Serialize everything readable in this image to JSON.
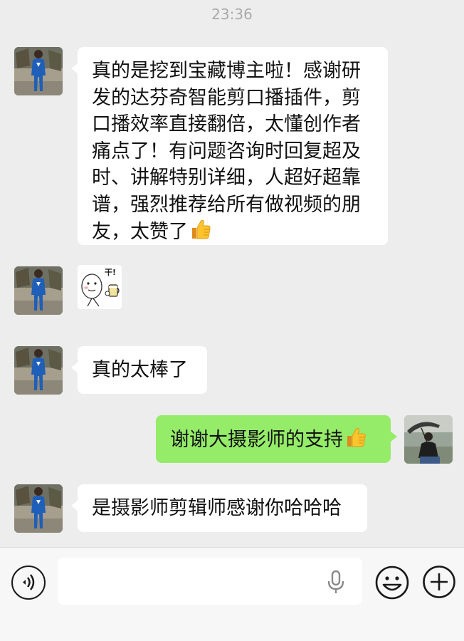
{
  "chat": {
    "timestamp": "23:36",
    "messages": [
      {
        "from": "contact",
        "type": "text",
        "text": "真的是挖到宝藏博主啦！感谢研发的达芬奇智能剪口播插件，剪口播效率直接翻倍，太懂创作者痛点了！有问题咨询时回复超及时、讲解特别详细，人超好超靠谱，强烈推荐给所有做视频的朋友，太赞了",
        "emoji": "thumbs-up-icon"
      },
      {
        "from": "contact",
        "type": "sticker",
        "sticker_text": "干!",
        "icon": "cheers-sticker"
      },
      {
        "from": "contact",
        "type": "text",
        "text": "真的太棒了"
      },
      {
        "from": "me",
        "type": "text",
        "text": "谢谢大摄影师的支持",
        "emoji": "thumbs-up-icon"
      },
      {
        "from": "contact",
        "type": "text",
        "text": "是摄影师剪辑师感谢你哈哈哈"
      }
    ]
  },
  "input_bar": {
    "voice_icon": "voice-icon",
    "mic_icon": "microphone-icon",
    "emoji_icon": "emoji-icon",
    "plus_icon": "plus-icon",
    "placeholder": ""
  },
  "colors": {
    "background": "#ededed",
    "incoming_bubble": "#ffffff",
    "outgoing_bubble": "#95ec69",
    "input_bar": "#f7f7f7"
  }
}
